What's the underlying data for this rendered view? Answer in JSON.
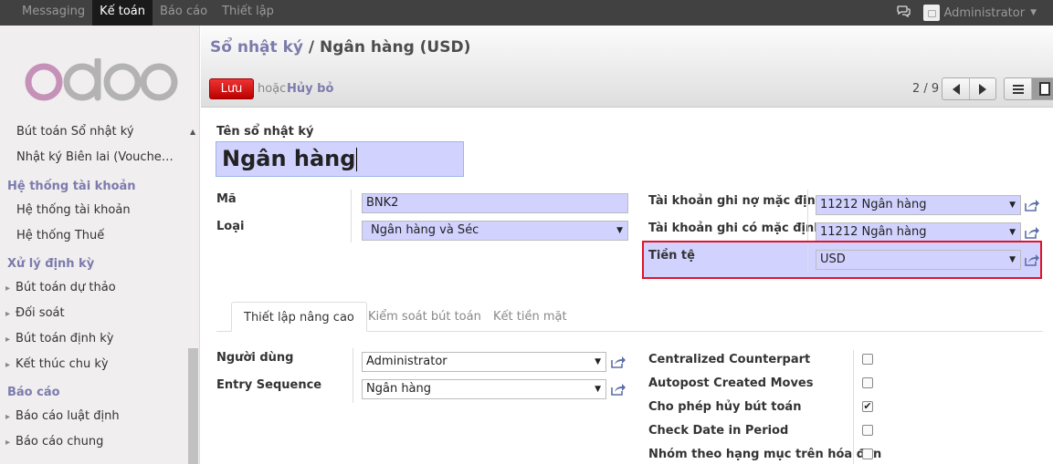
{
  "topbar": {
    "menu": [
      "Messaging",
      "Kế toán",
      "Báo cáo",
      "Thiết lập"
    ],
    "user": "Administrator"
  },
  "sidebar": {
    "items": [
      {
        "label": "Bút toán Sổ nhật ký",
        "type": "item"
      },
      {
        "label": "Nhật ký Biên lai (Vouche…",
        "type": "item"
      },
      {
        "label": "Hệ thống tài khoản",
        "type": "head"
      },
      {
        "label": "Hệ thống tài khoản",
        "type": "item"
      },
      {
        "label": "Hệ thống Thuế",
        "type": "item"
      },
      {
        "label": "Xử lý định kỳ",
        "type": "head"
      },
      {
        "label": "Bút toán dự thảo",
        "type": "arrow"
      },
      {
        "label": "Đối soát",
        "type": "arrow"
      },
      {
        "label": "Bút toán định kỳ",
        "type": "arrow"
      },
      {
        "label": "Kết thúc chu kỳ",
        "type": "arrow"
      },
      {
        "label": "Báo cáo",
        "type": "head"
      },
      {
        "label": "Báo cáo luật định",
        "type": "arrow"
      },
      {
        "label": "Báo cáo chung",
        "type": "arrow"
      }
    ]
  },
  "header": {
    "breadcrumb_parent": "Sổ nhật ký",
    "breadcrumb_sep": " / ",
    "breadcrumb_current": "Ngân hàng (USD)",
    "save_label": "Lưu",
    "or_label": "hoặc",
    "discard_label": "Hủy bỏ",
    "pager": "2 / 9"
  },
  "form": {
    "name_label": "Tên sổ nhật ký",
    "name_value": "Ngân hàng",
    "code_label": "Mã",
    "code_value": "BNK2",
    "type_label": "Loại",
    "type_value": "Ngân hàng và Séc",
    "debit_label": "Tài khoản ghi nợ mặc định",
    "debit_value": "11212 Ngân hàng",
    "credit_label": "Tài khoản ghi có mặc định",
    "credit_value": "11212 Ngân hàng",
    "currency_label": "Tiền tệ",
    "currency_value": "USD"
  },
  "tabs": [
    "Thiết lập nâng cao",
    "Kiểm soát bút toán",
    "Kết tiền mặt"
  ],
  "advanced": {
    "users_label": "Người dùng",
    "users_value": "Administrator",
    "sequence_label": "Entry Sequence",
    "sequence_value": "Ngân hàng",
    "checks": [
      {
        "label": "Centralized Counterpart",
        "checked": false
      },
      {
        "label": "Autopost Created Moves",
        "checked": false
      },
      {
        "label": "Cho phép hủy bút toán",
        "checked": true
      },
      {
        "label": "Check Date in Period",
        "checked": false
      },
      {
        "label": "Nhóm theo hạng mục trên hóa đơn",
        "checked": false
      }
    ]
  },
  "colors": {
    "accent": "#7c7bad",
    "required_bg": "#d2d2ff",
    "save": "#cc1111",
    "highlight_border": "#e0142a"
  }
}
